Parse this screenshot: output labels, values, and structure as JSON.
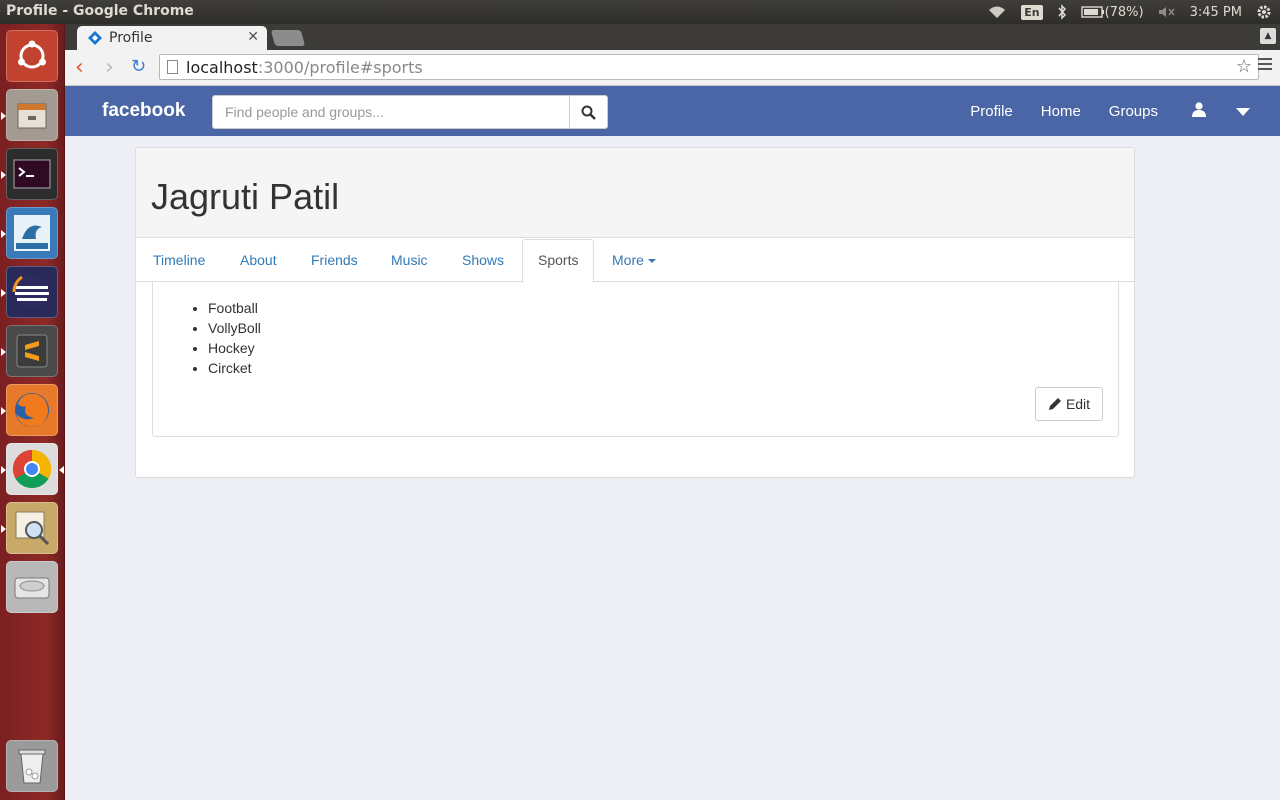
{
  "os": {
    "window_title": "Profile - Google Chrome",
    "tray": {
      "keyboard": "En",
      "battery": "(78%)",
      "clock": "3:45 PM"
    }
  },
  "browser": {
    "tab_title": "Profile",
    "url_host": "localhost",
    "url_rest": ":3000/profile#sports"
  },
  "navbar": {
    "brand": "facebook",
    "search_placeholder": "Find people and groups...",
    "links": {
      "profile": "Profile",
      "home": "Home",
      "groups": "Groups"
    }
  },
  "profile": {
    "name": "Jagruti Patil",
    "tabs": {
      "timeline": "Timeline",
      "about": "About",
      "friends": "Friends",
      "music": "Music",
      "shows": "Shows",
      "sports": "Sports",
      "more": "More"
    },
    "sports": [
      "Football",
      "VollyBoll",
      "Hockey",
      "Circket"
    ],
    "edit_label": "Edit"
  },
  "colors": {
    "navbar": "#4b66a6",
    "link": "#337ab7",
    "launcher": "#8e2a26"
  }
}
